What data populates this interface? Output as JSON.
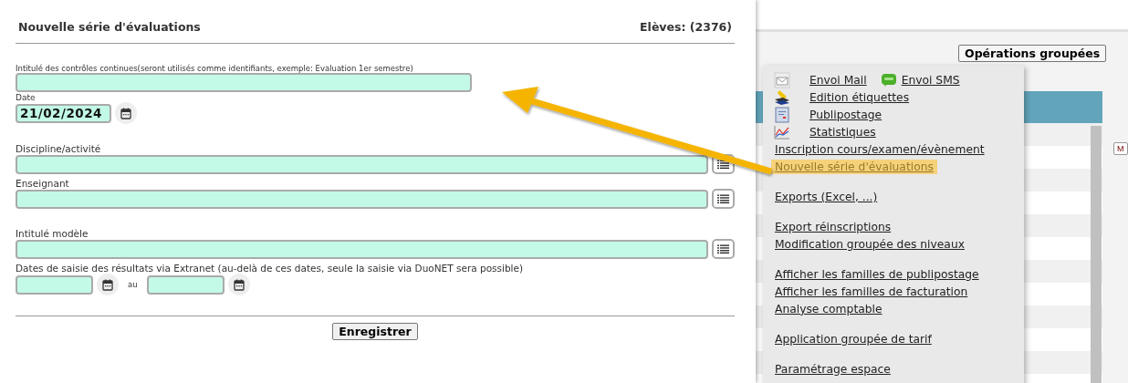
{
  "form": {
    "title": "Nouvelle série d'évaluations",
    "count": "Elèves: (2376)",
    "title_field": {
      "label": "Intitulé des contrôles continues(seront utilisés comme identifiants, exemple: Evaluation 1er semestre)"
    },
    "date_field": {
      "label": "Date",
      "value": "21/02/2024"
    },
    "list_fields": [
      {
        "label": "Discipline/activité"
      },
      {
        "label": "Enseignant"
      },
      {
        "label": "Intitulé modèle"
      }
    ],
    "extranet_dates": {
      "label": "Dates de saisie des résultats via Extranet (au-delà de ces dates, seule la saisie via DuoNET sera possible)",
      "separator": "au"
    },
    "save_button": "Enregistrer"
  },
  "background": {
    "button": "Opérations groupées",
    "side_button": "M"
  },
  "menu": {
    "groups": [
      [
        [
          {
            "label": "Envoi Mail",
            "kind": "mail",
            "selected": false
          },
          {
            "label": "Envoi SMS",
            "kind": "sms",
            "selected": false
          }
        ],
        [
          {
            "label": "Edition étiquettes",
            "kind": "labels",
            "selected": false
          }
        ],
        [
          {
            "label": "Publipostage",
            "kind": "document",
            "selected": false
          }
        ],
        [
          {
            "label": "Statistiques",
            "kind": "chart",
            "selected": false
          }
        ],
        [
          {
            "label": "Inscription cours/examen/évènement",
            "selected": false
          }
        ],
        [
          {
            "label": "Nouvelle série d'évaluations",
            "selected": true
          }
        ]
      ],
      [
        [
          {
            "label": "Exports (Excel, ...)",
            "selected": false
          }
        ]
      ],
      [
        [
          {
            "label": "Export réinscriptions",
            "selected": false
          }
        ],
        [
          {
            "label": "Modification groupée des niveaux",
            "selected": false
          }
        ]
      ],
      [
        [
          {
            "label": "Afficher les familles de publipostage",
            "selected": false
          }
        ],
        [
          {
            "label": "Afficher les familles de facturation",
            "selected": false
          }
        ],
        [
          {
            "label": "Analyse comptable",
            "selected": false
          }
        ]
      ],
      [
        [
          {
            "label": "Application groupée de tarif",
            "selected": false
          }
        ]
      ],
      [
        [
          {
            "label": "Paramétrage espace",
            "selected": false
          }
        ]
      ]
    ]
  }
}
